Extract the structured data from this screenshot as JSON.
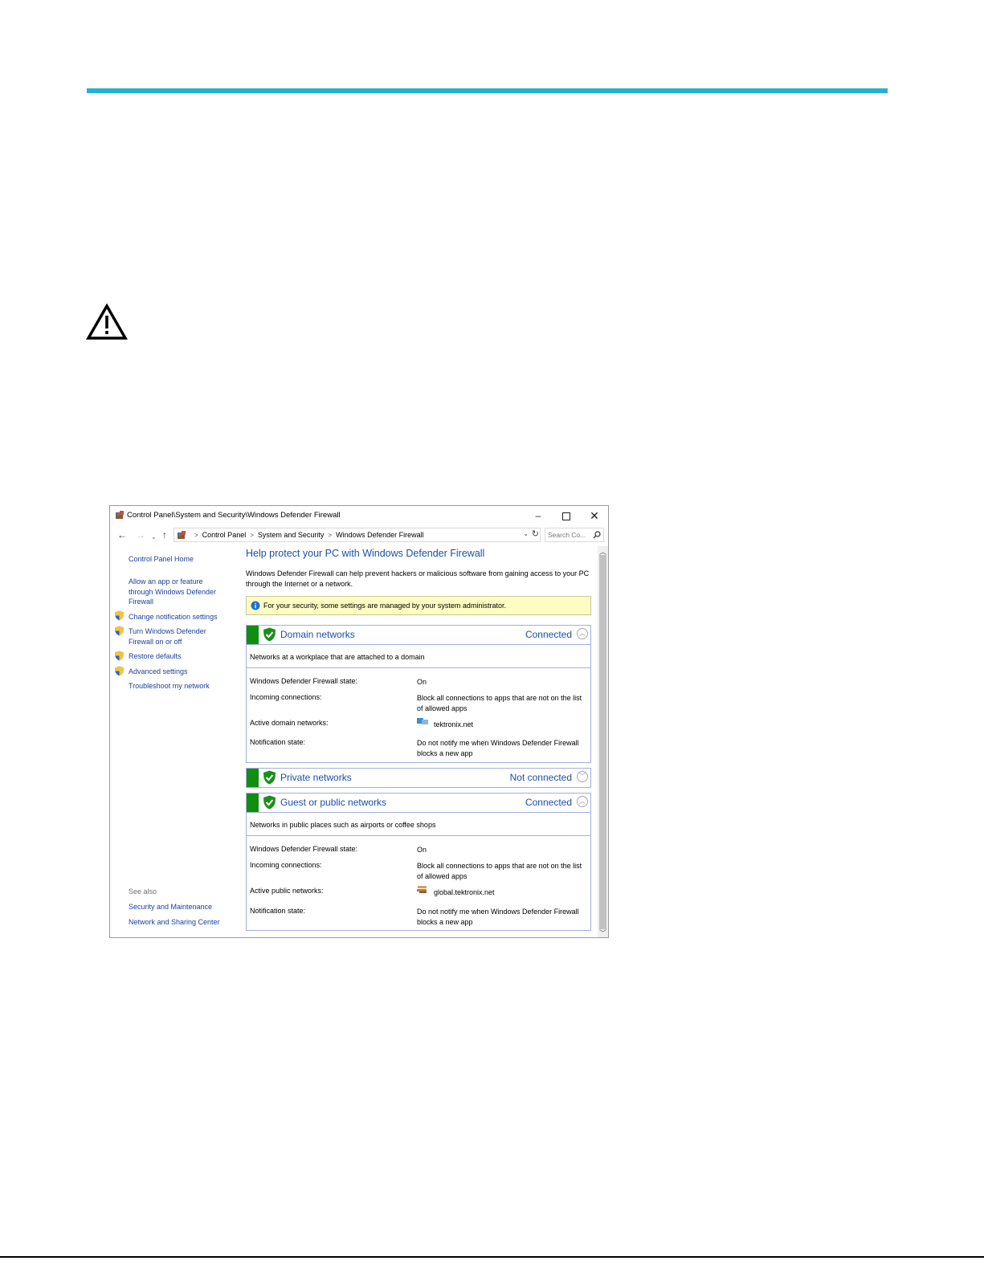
{
  "window": {
    "title": "Control Panel\\System and Security\\Windows Defender Firewall",
    "controls": {
      "minimize": "–",
      "close": "✕"
    }
  },
  "address": {
    "crumbs": [
      "Control Panel",
      "System and Security",
      "Windows Defender Firewall"
    ],
    "separator": ">",
    "search_placeholder": "Search Co..."
  },
  "sidebar": {
    "home": "Control Panel Home",
    "links": [
      {
        "label": "Allow an app or feature through Windows Defender Firewall",
        "shield": false
      },
      {
        "label": "Change notification settings",
        "shield": true
      },
      {
        "label": "Turn Windows Defender Firewall on or off",
        "shield": true
      },
      {
        "label": "Restore defaults",
        "shield": true
      },
      {
        "label": "Advanced settings",
        "shield": true
      },
      {
        "label": "Troubleshoot my network",
        "shield": false
      }
    ],
    "see_also": "See also",
    "see_also_links": [
      "Security and Maintenance",
      "Network and Sharing Center"
    ]
  },
  "main": {
    "heading": "Help protect your PC with Windows Defender Firewall",
    "intro": "Windows Defender Firewall can help prevent hackers or malicious software from gaining access to your PC through the Internet or a network.",
    "info": "For your security, some settings are managed by your system administrator.",
    "domain": {
      "title": "Domain networks",
      "status": "Connected",
      "description": "Networks at a workplace that are attached to a domain",
      "rows": [
        {
          "label": "Windows Defender Firewall state:",
          "value": "On"
        },
        {
          "label": "Incoming connections:",
          "value": "Block all connections to apps that are not on the list of allowed apps"
        },
        {
          "label": "Active domain networks:",
          "value": "tektronix.net"
        },
        {
          "label": "Notification state:",
          "value": "Do not notify me when Windows Defender Firewall blocks a new app"
        }
      ]
    },
    "private": {
      "title": "Private networks",
      "status": "Not connected"
    },
    "public": {
      "title": "Guest or public networks",
      "status": "Connected",
      "description": "Networks in public places such as airports or coffee shops",
      "rows": [
        {
          "label": "Windows Defender Firewall state:",
          "value": "On"
        },
        {
          "label": "Incoming connections:",
          "value": "Block all connections to apps that are not on the list of allowed apps"
        },
        {
          "label": "Active public networks:",
          "value": "global.tektronix.net"
        },
        {
          "label": "Notification state:",
          "value": "Do not notify me when Windows Defender Firewall blocks a new app"
        }
      ]
    }
  },
  "colors": {
    "accent_rule": "#22b3d3",
    "link_blue": "#1a3f9c",
    "status_green": "#108e10",
    "info_yellow": "#fcfcc3"
  },
  "icons": {
    "document": "warning-triangle-icon",
    "shield": "uac-shield-icon",
    "status": "green-check-shield-icon"
  }
}
